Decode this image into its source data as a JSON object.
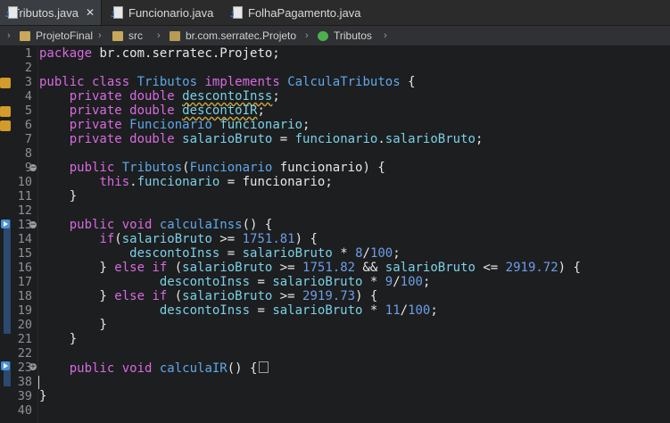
{
  "tabs": [
    {
      "label": "Tributos.java",
      "active": true,
      "close": "✕"
    },
    {
      "label": "Funcionario.java",
      "active": false
    },
    {
      "label": "FolhaPagamento.java",
      "active": false
    }
  ],
  "breadcrumb": {
    "items": [
      "ProjetoFinal",
      "src",
      "br.com.serratec.Projeto",
      "Tributos"
    ]
  },
  "editor": {
    "line_numbers": [
      "1",
      "2",
      "3",
      "4",
      "5",
      "6",
      "7",
      "8",
      "9",
      "10",
      "11",
      "12",
      "13",
      "14",
      "15",
      "16",
      "17",
      "18",
      "19",
      "20",
      "21",
      "22",
      "23",
      "38",
      "39",
      "40"
    ]
  },
  "colors": {
    "keyword": "#d86ae0",
    "type": "#5ea8e8",
    "field": "#7ad1e6",
    "number": "#6b9fe8",
    "text": "#e6e6e6",
    "background": "#1d1e20"
  }
}
